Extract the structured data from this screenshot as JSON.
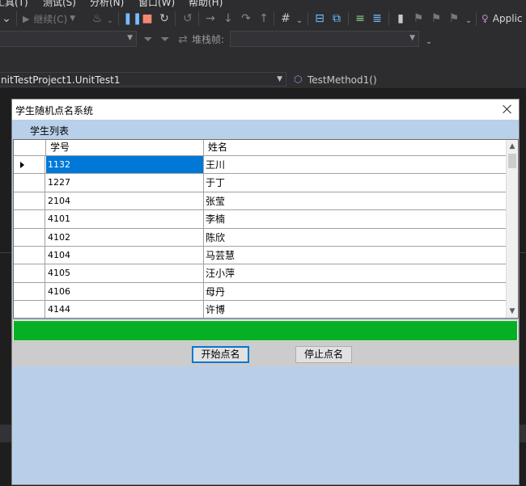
{
  "ide": {
    "menu_items": [
      "工具(T)",
      "测试(S)",
      "分析(N)",
      "窗口(W)",
      "帮助(H)"
    ],
    "continue_label": "继续(C)",
    "app_label": "Applic",
    "stack_frame_label": "堆栈帧:",
    "nav_left": "nitTestProject1.UnitTest1",
    "nav_right": "TestMethod1()"
  },
  "dialog": {
    "title": "学生随机点名系统",
    "group_title": "学生列表"
  },
  "grid": {
    "columns": [
      "学号",
      "姓名"
    ],
    "rows": [
      {
        "id": "1132",
        "name": "王川"
      },
      {
        "id": "1227",
        "name": "于丁"
      },
      {
        "id": "2104",
        "name": "张莹"
      },
      {
        "id": "4101",
        "name": "李楠"
      },
      {
        "id": "4102",
        "name": "陈欣"
      },
      {
        "id": "4104",
        "name": "马芸慧"
      },
      {
        "id": "4105",
        "name": "汪小萍"
      },
      {
        "id": "4106",
        "name": "母丹"
      },
      {
        "id": "4144",
        "name": "许博"
      }
    ],
    "selected_row": 0
  },
  "progress": {
    "value": 1.0
  },
  "buttons": {
    "start": "开始点名",
    "stop": "停止点名"
  },
  "colors": {
    "progress_fill": "#06b025",
    "selection": "#0078d7",
    "dialog_bg": "#b9cfe9"
  }
}
